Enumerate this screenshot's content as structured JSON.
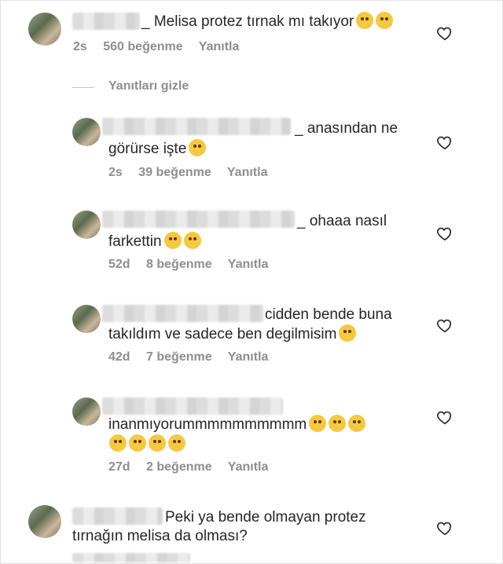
{
  "comments": [
    {
      "text": "_ Melisa protez tırnak mı takıyor",
      "time": "2s",
      "likes": "560 beğenme",
      "reply": "Yanıtla"
    },
    {
      "text_line1": "_ anasından ne",
      "text_line2": "görürse işte",
      "time": "2s",
      "likes": "39 beğenme",
      "reply": "Yanıtla"
    },
    {
      "text_line1": "_ ohaaa nasıl",
      "text_line2": "farkettin",
      "time": "52d",
      "likes": "8 beğenme",
      "reply": "Yanıtla"
    },
    {
      "text_line1": "cidden bende buna",
      "text_line2": "takıldım ve sadece ben degilmisim",
      "time": "42d",
      "likes": "7 beğenme",
      "reply": "Yanıtla"
    },
    {
      "text_line1": "inanmıyorummmmmmmmmm",
      "time": "27d",
      "likes": "2 beğenme",
      "reply": "Yanıtla"
    },
    {
      "text_line1": "Peki ya bende olmayan protez",
      "text_line2": "tırnağın melisa da olması?"
    }
  ],
  "hide_replies": "Yanıtları gizle",
  "icons": {
    "like": "heart-outline-icon",
    "emoji": "emoji-icon"
  }
}
